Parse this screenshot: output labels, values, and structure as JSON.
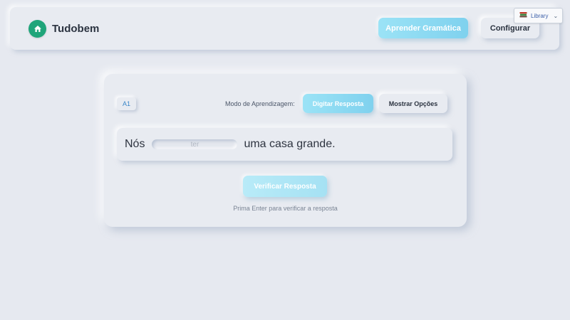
{
  "header": {
    "brand_name": "Tudobem",
    "learn_button": "Aprender Gramática",
    "config_button": "Configurar"
  },
  "library": {
    "label": "Library",
    "icon": "books-icon"
  },
  "exercise": {
    "level": "A1",
    "mode_label": "Modo de Aprendizagem:",
    "mode_type_button": "Digitar Resposta",
    "mode_options_button": "Mostrar Opções",
    "active_mode": "Digitar Resposta",
    "sentence_before": "Nós",
    "sentence_after": "uma casa grande.",
    "input_placeholder": "ter",
    "input_value": "",
    "verify_button": "Verificar Resposta",
    "hint": "Prima Enter para verificar a resposta"
  },
  "colors": {
    "background": "#e6e9f0",
    "accent": "#7fd1ee",
    "logo": "#1fa57a",
    "level_text": "#3a86c8"
  }
}
